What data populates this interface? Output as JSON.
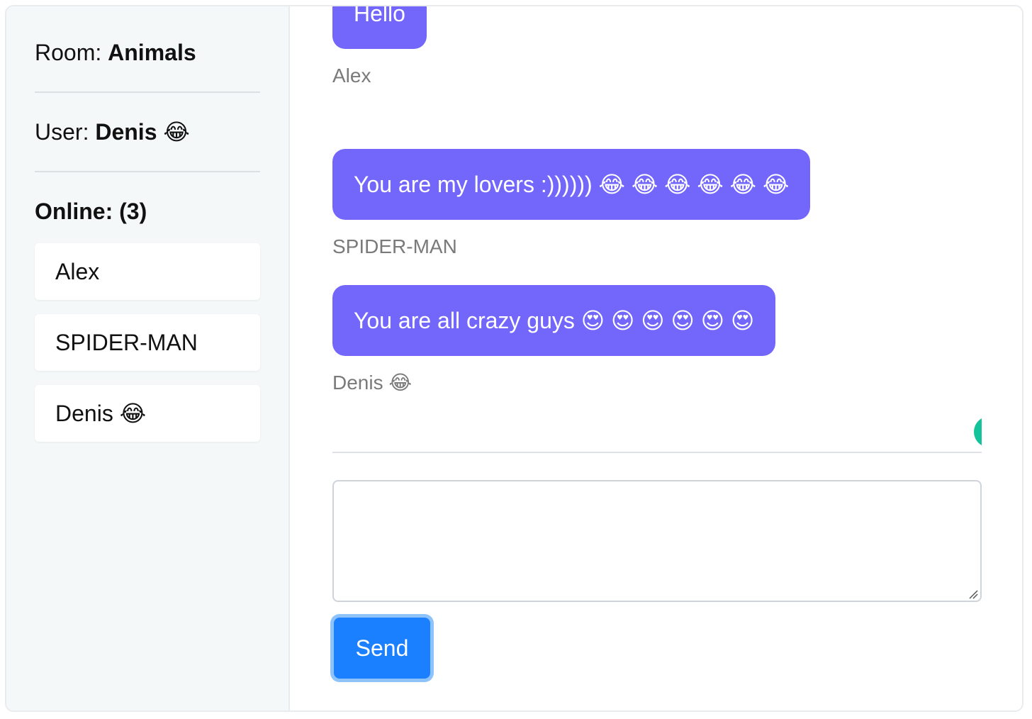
{
  "sidebar": {
    "room_label": "Room: ",
    "room_name": "Animals",
    "user_label": "User: ",
    "user_name": "Denis 😂",
    "online_title": "Online: (3)",
    "online_users": [
      "Alex",
      "SPIDER-MAN",
      "Denis 😂"
    ]
  },
  "messages": [
    {
      "text": "Hello",
      "author": "Alex"
    },
    {
      "text": "You are my lovers :)))))) 😂 😂 😂 😂 😂 😂",
      "author": "SPIDER-MAN"
    },
    {
      "text": "You are all crazy guys 😍  😍  😍  😍  😍  😍",
      "author": "Denis 😂"
    }
  ],
  "composer": {
    "value": "",
    "send_label": "Send"
  },
  "colors": {
    "bubble": "#7366fb",
    "send_button": "#1a80ff",
    "grammarly": "#15c39a"
  }
}
